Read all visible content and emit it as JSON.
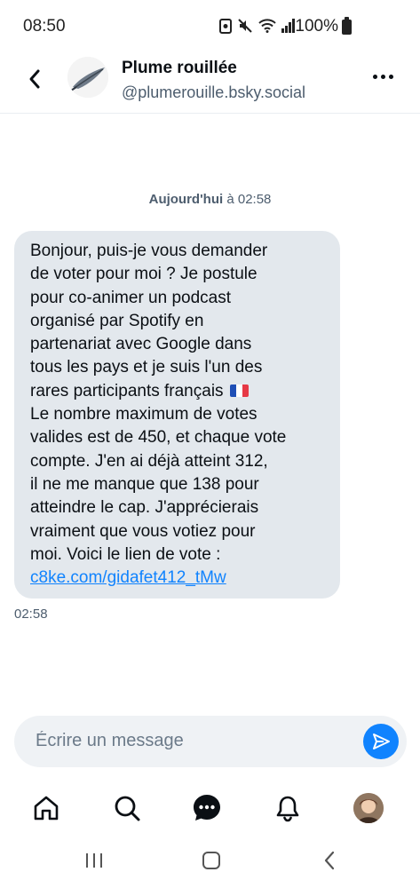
{
  "status_bar": {
    "time": "08:50",
    "battery": "100%"
  },
  "header": {
    "contact_name": "Plume rouillée",
    "contact_handle": "@plumerouille.bsky.social"
  },
  "conversation": {
    "date_day": "Aujourd'hui",
    "date_time_text": " à 02:58",
    "message": {
      "text": "Bonjour, puis-je vous demander\nde voter pour moi ? Je postule\npour co-animer un podcast\norganisé par Spotify en\npartenariat avec Google dans\ntous les pays et je suis l'un des\nrares participants français",
      "text_after_flag": "\nLe nombre maximum de votes\nvalides est de 450, et chaque vote\ncompte. J'en ai déjà atteint 312,\nil ne me manque que 138 pour\natteindre le cap. J'apprécierais\nvraiment que vous votiez pour\nmoi. Voici le lien de vote :\n",
      "link": "c8ke.com/gidafet412_tMw",
      "time": "02:58"
    }
  },
  "composer": {
    "placeholder": "Écrire un message"
  },
  "bottom_nav": {
    "items": [
      "home-icon",
      "search-icon",
      "chat-icon",
      "bell-icon",
      "profile-avatar"
    ]
  },
  "colors": {
    "accent": "#1083fe",
    "bubble": "#e3e8ed",
    "muted_text": "#4d5d6e"
  }
}
